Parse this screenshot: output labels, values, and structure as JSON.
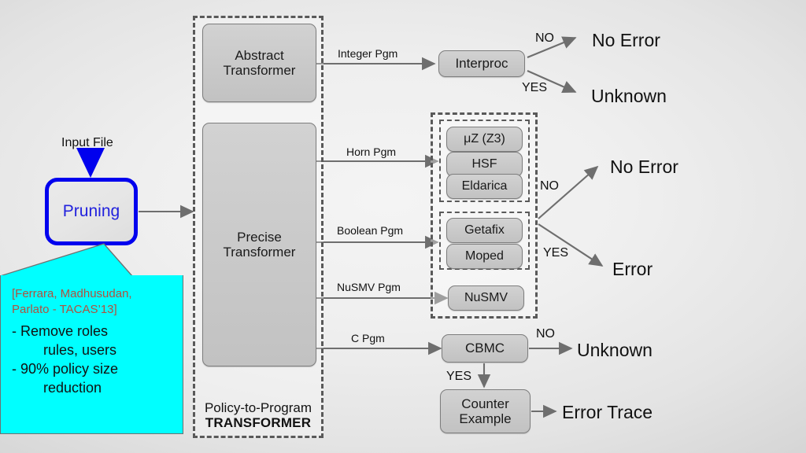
{
  "diagram": {
    "title": "Policy-to-Program Transformer verification pipeline",
    "background_color": "#e9e9e9"
  },
  "input": {
    "label": "Input File",
    "arrow": "down-arrow-icon"
  },
  "pruning": {
    "label": "Pruning",
    "border_color": "#0000ee",
    "text_color": "#2222dd"
  },
  "callout": {
    "fill_color": "#00ffff",
    "citation_color": "#b0513f",
    "citation": [
      "[Ferrara, Madhusudan,",
      "Parlato - TACAS’13]"
    ],
    "lines": [
      "- Remove roles",
      "        rules, users",
      "- 90% policy size",
      "        reduction"
    ]
  },
  "transformer_container": {
    "caption_line1": "Policy-to-Program",
    "caption_line2": "TRANSFORMER",
    "boxes": [
      {
        "id": "abstract-transformer",
        "lines": [
          "Abstract",
          "Transformer"
        ]
      },
      {
        "id": "precise-transformer",
        "lines": [
          "Precise",
          "Transformer"
        ]
      }
    ]
  },
  "edges": [
    {
      "id": "integer-pgm",
      "label": "Integer Pgm"
    },
    {
      "id": "horn-pgm",
      "label": "Horn Pgm"
    },
    {
      "id": "boolean-pgm",
      "label": "Boolean Pgm"
    },
    {
      "id": "nusmv-pgm",
      "label": "NuSMV Pgm"
    },
    {
      "id": "c-pgm",
      "label": "C Pgm"
    }
  ],
  "tools": {
    "interproc": {
      "label": "Interproc"
    },
    "horn_group": [
      {
        "label": "μZ (Z3)"
      },
      {
        "label": "HSF"
      },
      {
        "label": "Eldarica"
      }
    ],
    "boolean_group": [
      {
        "label": "Getafix"
      },
      {
        "label": "Moped"
      }
    ],
    "nusmv_group": [
      {
        "label": "NuSMV"
      }
    ],
    "cbmc": {
      "label": "CBMC"
    },
    "counter_example": {
      "lines": [
        "Counter",
        "Example"
      ]
    }
  },
  "branches": {
    "interproc_no": "NO",
    "interproc_yes": "YES",
    "solvers_no": "NO",
    "solvers_yes": "YES",
    "cbmc_no": "NO",
    "cbmc_yes": "YES"
  },
  "outcomes": {
    "interproc_no": "No Error",
    "interproc_yes": "Unknown",
    "solvers_no": "No Error",
    "solvers_yes": "Error",
    "cbmc_no": "Unknown",
    "counter_example": "Error Trace"
  }
}
